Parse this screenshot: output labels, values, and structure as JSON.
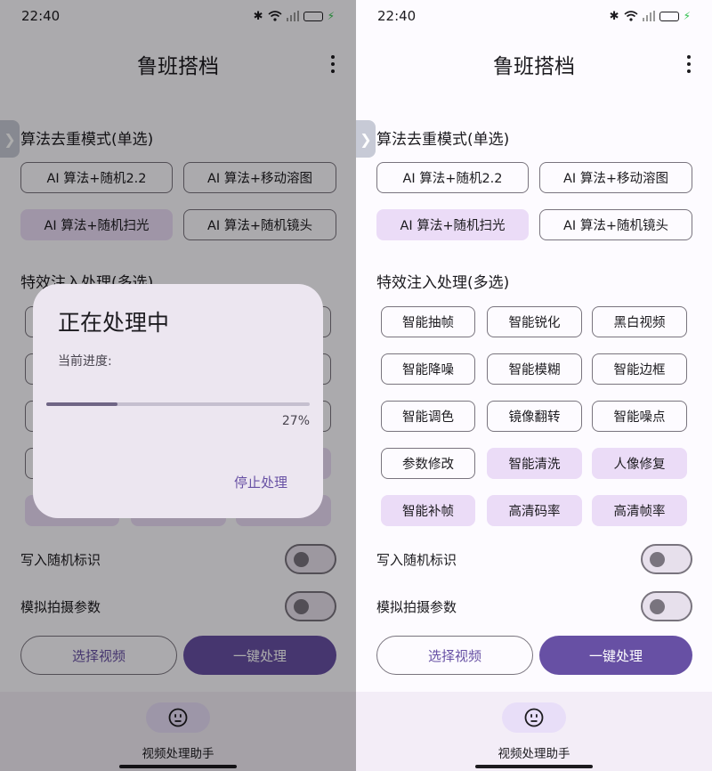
{
  "status": {
    "time": "22:40"
  },
  "app": {
    "title": "鲁班搭档"
  },
  "side_tab": {
    "glyph": "❯"
  },
  "algo": {
    "title": "算法去重模式(单选)",
    "options": [
      {
        "label": "AI 算法+随机2.2",
        "selected": false
      },
      {
        "label": "AI 算法+移动溶图",
        "selected": false
      },
      {
        "label": "AI 算法+随机扫光",
        "selected": true
      },
      {
        "label": "AI 算法+随机镜头",
        "selected": false
      }
    ]
  },
  "effects": {
    "title": "特效注入处理(多选)",
    "options": [
      {
        "label": "智能抽帧",
        "selected": false
      },
      {
        "label": "智能锐化",
        "selected": false
      },
      {
        "label": "黑白视频",
        "selected": false
      },
      {
        "label": "智能降噪",
        "selected": false
      },
      {
        "label": "智能模糊",
        "selected": false
      },
      {
        "label": "智能边框",
        "selected": false
      },
      {
        "label": "智能调色",
        "selected": false
      },
      {
        "label": "镜像翻转",
        "selected": false
      },
      {
        "label": "智能噪点",
        "selected": false
      },
      {
        "label": "参数修改",
        "selected": false
      },
      {
        "label": "智能清洗",
        "selected": true
      },
      {
        "label": "人像修复",
        "selected": true
      },
      {
        "label": "智能补帧",
        "selected": true
      },
      {
        "label": "高清码率",
        "selected": true
      },
      {
        "label": "高清帧率",
        "selected": true
      }
    ]
  },
  "switches": [
    {
      "label": "写入随机标识",
      "on": false
    },
    {
      "label": "模拟拍摄参数",
      "on": false
    }
  ],
  "buttons": {
    "select_video": "选择视频",
    "process": "一键处理"
  },
  "nav": {
    "label": "视频处理助手"
  },
  "dialog": {
    "title": "正在处理中",
    "label": "当前进度:",
    "progress_percent": 27,
    "percent_text": "27%",
    "stop_label": "停止处理"
  },
  "colors": {
    "primary": "#6750a4",
    "selected_chip": "#ebdcf7",
    "battery": "#2fc14d"
  }
}
